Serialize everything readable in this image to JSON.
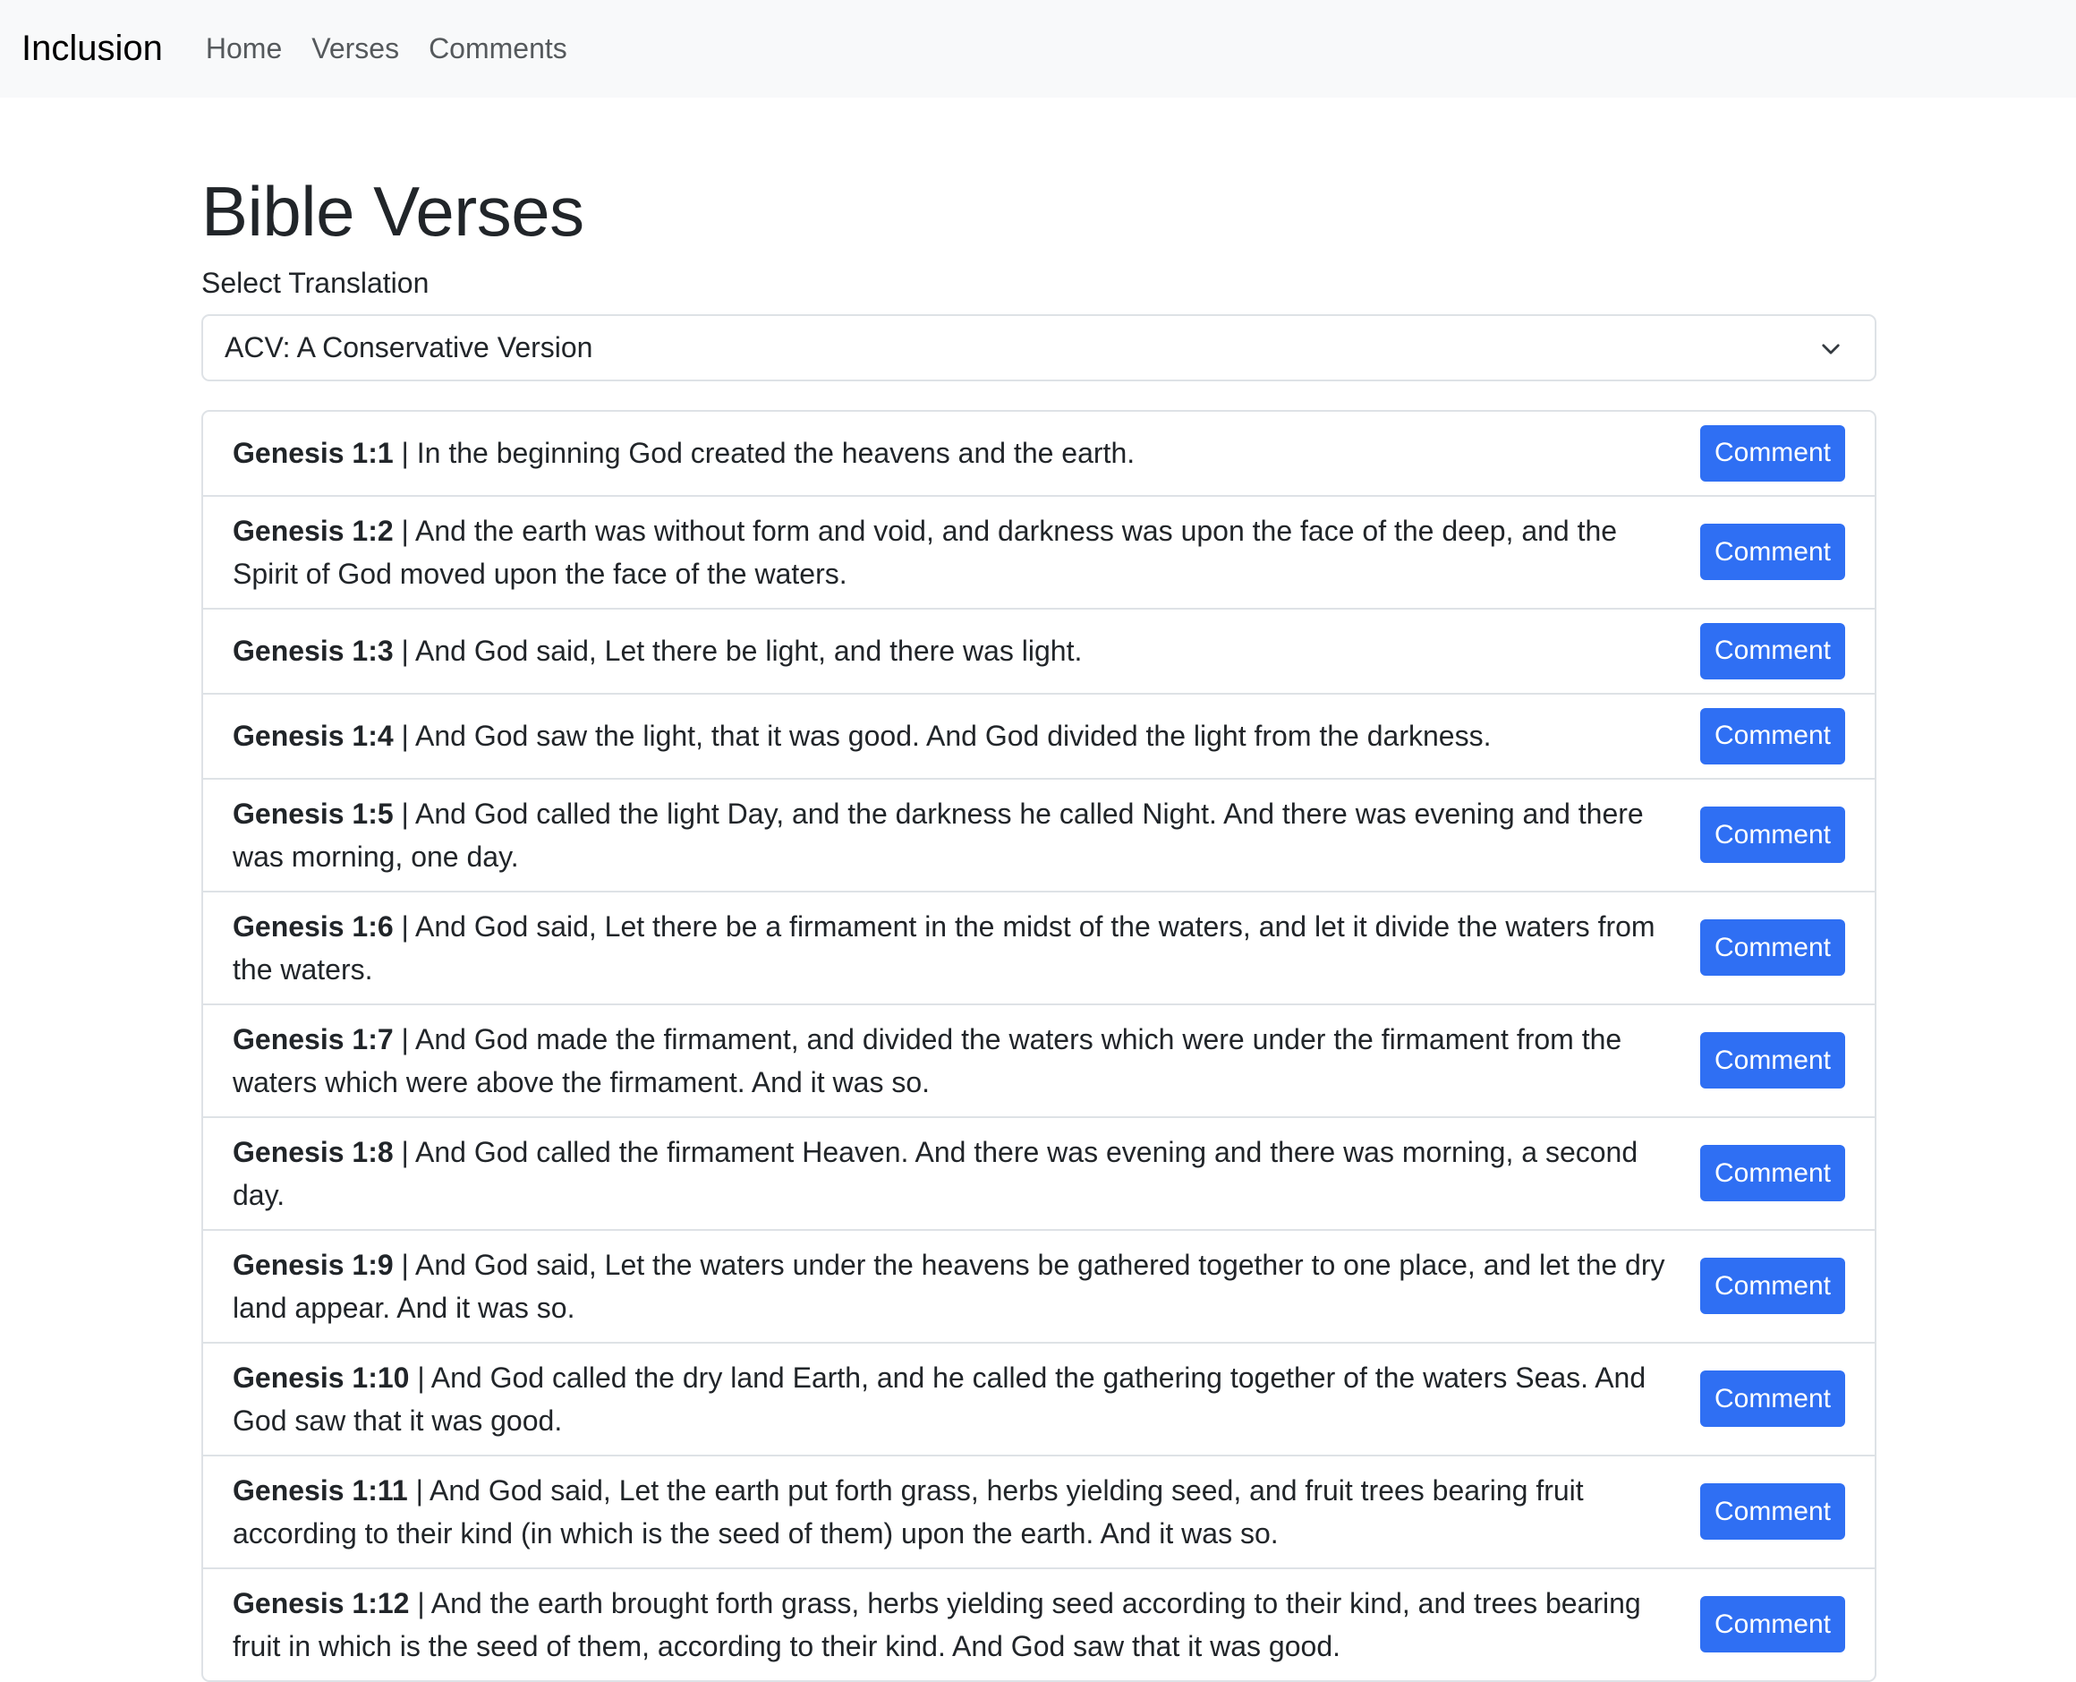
{
  "nav": {
    "brand": "Inclusion",
    "links": [
      "Home",
      "Verses",
      "Comments"
    ]
  },
  "page": {
    "title": "Bible Verses",
    "select_label": "Select Translation",
    "selected_translation": "ACV: A Conservative Version"
  },
  "comment_label": "Comment",
  "verses": [
    {
      "ref": "Genesis 1:1",
      "text": " | In the beginning God created the heavens and the earth."
    },
    {
      "ref": "Genesis 1:2",
      "text": " | And the earth was without form and void, and darkness was upon the face of the deep, and the Spirit of God moved upon the face of the waters."
    },
    {
      "ref": "Genesis 1:3",
      "text": " | And God said, Let there be light, and there was light."
    },
    {
      "ref": "Genesis 1:4",
      "text": " | And God saw the light, that it was good. And God divided the light from the darkness."
    },
    {
      "ref": "Genesis 1:5",
      "text": " | And God called the light Day, and the darkness he called Night. And there was evening and there was morning, one day."
    },
    {
      "ref": "Genesis 1:6",
      "text": " | And God said, Let there be a firmament in the midst of the waters, and let it divide the waters from the waters."
    },
    {
      "ref": "Genesis 1:7",
      "text": " | And God made the firmament, and divided the waters which were under the firmament from the waters which were above the firmament. And it was so."
    },
    {
      "ref": "Genesis 1:8",
      "text": " | And God called the firmament Heaven. And there was evening and there was morning, a second day."
    },
    {
      "ref": "Genesis 1:9",
      "text": " | And God said, Let the waters under the heavens be gathered together to one place, and let the dry land appear. And it was so."
    },
    {
      "ref": "Genesis 1:10",
      "text": " | And God called the dry land Earth, and he called the gathering together of the waters Seas. And God saw that it was good."
    },
    {
      "ref": "Genesis 1:11",
      "text": " | And God said, Let the earth put forth grass, herbs yielding seed, and fruit trees bearing fruit according to their kind (in which is the seed of them) upon the earth. And it was so."
    },
    {
      "ref": "Genesis 1:12",
      "text": " | And the earth brought forth grass, herbs yielding seed according to their kind, and trees bearing fruit in which is the seed of them, according to their kind. And God saw that it was good."
    }
  ]
}
